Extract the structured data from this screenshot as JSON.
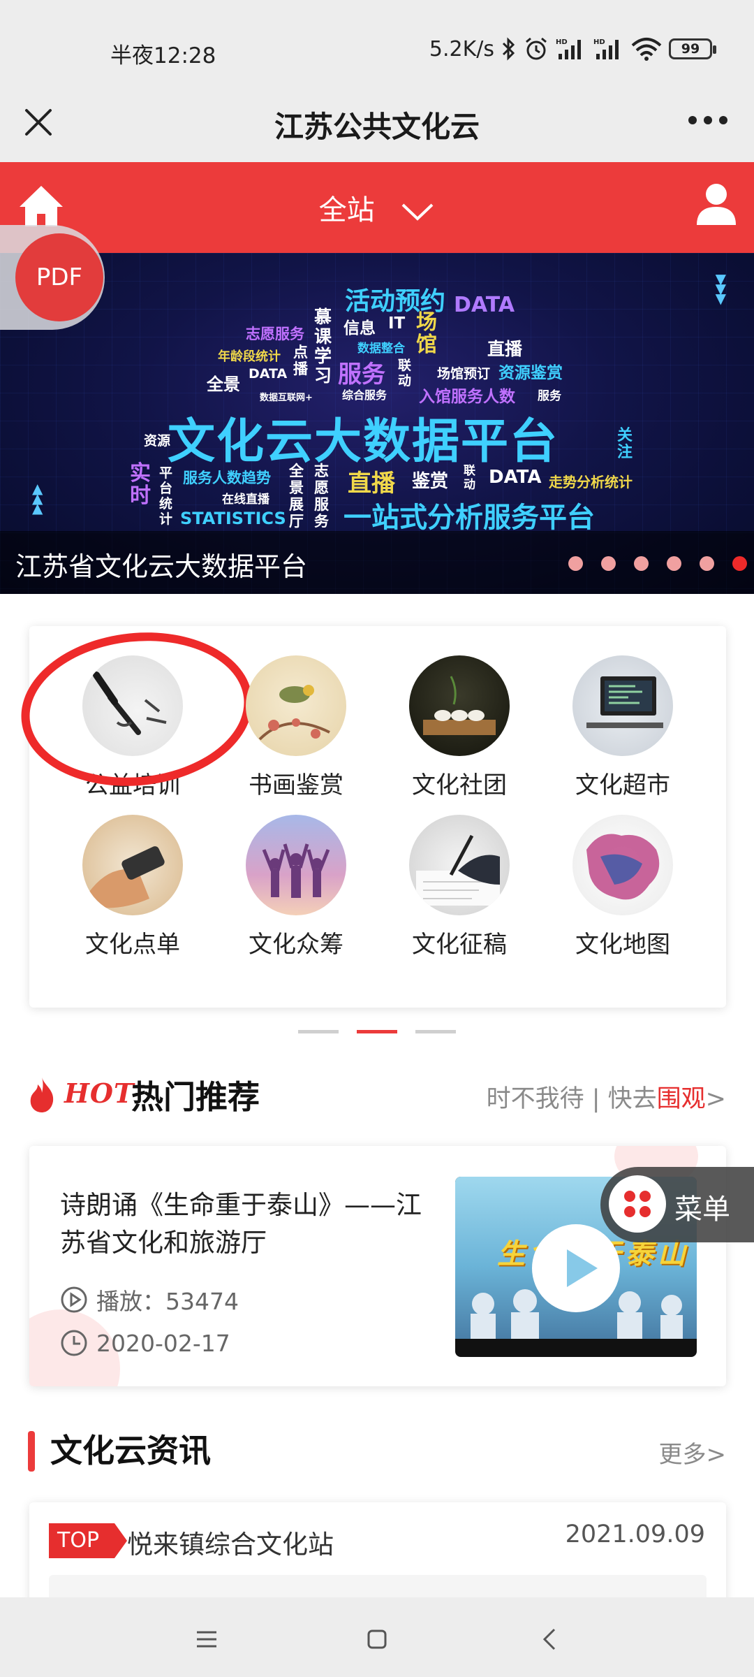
{
  "status_bar": {
    "time": "半夜12:28",
    "network_speed": "5.2K/s",
    "battery": "99",
    "icons": [
      "bluetooth-icon",
      "alarm-icon",
      "hd-signal-icon",
      "hd-signal-icon",
      "wifi-icon",
      "battery-icon"
    ]
  },
  "titlebar": {
    "title": "江苏公共文化云",
    "icons": [
      "close-icon",
      "more-icon"
    ]
  },
  "header": {
    "site_label": "全站",
    "icons": [
      "home-icon",
      "chevron-down-icon",
      "user-icon"
    ],
    "color": "#ec3b3b"
  },
  "pdf_badge": {
    "label": "PDF"
  },
  "banner": {
    "caption": "江苏省文化云大数据平台",
    "slide_count": 6,
    "active_slide": 6,
    "words": {
      "w1": "活动预约",
      "w2": "志愿服务",
      "w3": "慕课学习",
      "w4": "信息",
      "w5": "IT",
      "w6": "场馆",
      "w7": "DATA",
      "w8": "直播",
      "w9": "年龄段统计",
      "w10": "点播",
      "w11": "数据整合",
      "w12": "服务",
      "w13": "联动",
      "w14": "场馆预订",
      "w15": "资源鉴赏",
      "w16": "全景",
      "w17": "DATA",
      "w18": "综合服务",
      "w19": "入馆服务人数",
      "w20": "服务",
      "w21": "数据互联网+",
      "w22": "资源",
      "w23": "文化云大数据平台",
      "w24": "关注",
      "w25": "实时",
      "w26": "平台统计",
      "w27": "服务人数趋势",
      "w28": "全景展厅",
      "w29": "志愿服务",
      "w30": "直播",
      "w31": "鉴赏",
      "w32": "联动",
      "w33": "DATA",
      "w34": "走势分析统计",
      "w35": "在线直播",
      "w36": "STATISTICS",
      "w37": "一站式分析服务平台"
    }
  },
  "categories": [
    {
      "label": "公益培训"
    },
    {
      "label": "书画鉴赏"
    },
    {
      "label": "文化社团"
    },
    {
      "label": "文化超市"
    },
    {
      "label": "文化点单"
    },
    {
      "label": "文化众筹"
    },
    {
      "label": "文化征稿"
    },
    {
      "label": "文化地图"
    }
  ],
  "category_pager": {
    "pages": 3,
    "active": 2
  },
  "hot": {
    "badge": "HOT",
    "title": "热门推荐",
    "more_prefix": "时不我待 | 快去",
    "more_accent": "围观",
    "more_suffix": ">",
    "item": {
      "title": "诗朗诵《生命重于泰山》——江苏省文化和旅游厅",
      "plays": "播放：53474",
      "date": "2020-02-17",
      "thumb_text": "生命重于泰山"
    }
  },
  "menu": {
    "label": "菜单"
  },
  "news": {
    "title": "文化云资讯",
    "more": "更多>",
    "item": {
      "tag": "TOP",
      "title": "悦来镇综合文化站",
      "date": "2021.09.09"
    }
  },
  "navbar": {
    "icons": [
      "menu-icon",
      "home-square-icon",
      "back-icon"
    ]
  }
}
